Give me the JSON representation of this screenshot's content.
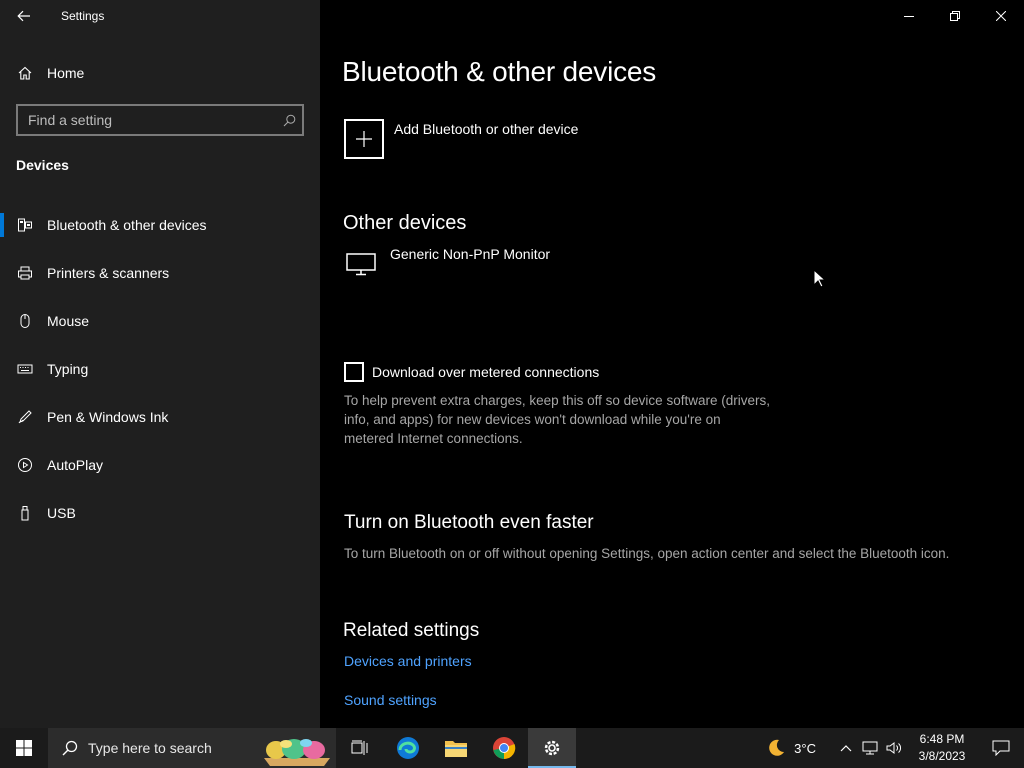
{
  "window": {
    "title": "Settings"
  },
  "sidebar": {
    "home_label": "Home",
    "search_placeholder": "Find a setting",
    "section_title": "Devices",
    "items": [
      {
        "label": "Bluetooth & other devices",
        "icon": "bluetooth-devices-icon",
        "selected": true
      },
      {
        "label": "Printers & scanners",
        "icon": "printer-icon",
        "selected": false
      },
      {
        "label": "Mouse",
        "icon": "mouse-icon",
        "selected": false
      },
      {
        "label": "Typing",
        "icon": "keyboard-icon",
        "selected": false
      },
      {
        "label": "Pen & Windows Ink",
        "icon": "pen-icon",
        "selected": false
      },
      {
        "label": "AutoPlay",
        "icon": "autoplay-icon",
        "selected": false
      },
      {
        "label": "USB",
        "icon": "usb-icon",
        "selected": false
      }
    ]
  },
  "main": {
    "page_title": "Bluetooth & other devices",
    "add_device_label": "Add Bluetooth or other device",
    "other_devices_heading": "Other devices",
    "devices": [
      {
        "label": "Generic Non-PnP Monitor",
        "icon": "monitor-icon"
      }
    ],
    "metered": {
      "label": "Download over metered connections",
      "checked": false,
      "description_lines": [
        "To help prevent extra charges, keep this off so device software (drivers,",
        "info, and apps) for new devices won't download while you're on",
        "metered Internet connections."
      ]
    },
    "faster": {
      "heading": "Turn on Bluetooth even faster",
      "description": "To turn Bluetooth on or off without opening Settings, open action center and select the Bluetooth icon."
    },
    "related": {
      "heading": "Related settings",
      "links": [
        "Devices and printers",
        "Sound settings"
      ]
    }
  },
  "taskbar": {
    "search_placeholder": "Type here to search",
    "weather": "3°C",
    "time": "6:48 PM",
    "date": "3/8/2023"
  },
  "colors": {
    "accent": "#0078d7",
    "link": "#4fa3ff",
    "sidebar_bg": "#1f1f1f",
    "main_bg": "#000000"
  }
}
